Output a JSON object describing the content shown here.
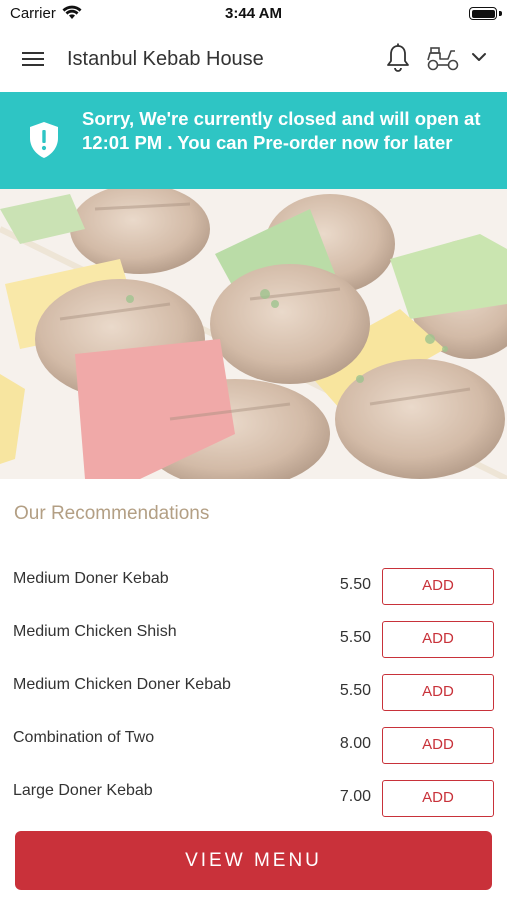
{
  "status_bar": {
    "carrier": "Carrier",
    "time": "3:44 AM"
  },
  "header": {
    "title": "Istanbul Kebab House"
  },
  "banner": {
    "message": "Sorry, We're currently closed and will open at 12:01 PM . You can Pre-order now for later"
  },
  "recommendations": {
    "heading": "Our Recommendations",
    "add_label": "ADD",
    "items": [
      {
        "name": "Medium Doner Kebab",
        "price": "5.50"
      },
      {
        "name": "Medium Chicken Shish",
        "price": "5.50"
      },
      {
        "name": "Medium Chicken Doner Kebab",
        "price": "5.50"
      },
      {
        "name": "Combination of Two",
        "price": "8.00"
      },
      {
        "name": "Large Doner Kebab",
        "price": "7.00"
      }
    ]
  },
  "view_menu_label": "VIEW MENU",
  "colors": {
    "banner": "#2ec5c4",
    "accent": "#c9313a",
    "heading": "#b39f84"
  },
  "icons": [
    "menu-icon",
    "bell-icon",
    "scooter-icon",
    "chevron-down-icon",
    "shield-icon",
    "wifi-icon",
    "battery-icon"
  ]
}
